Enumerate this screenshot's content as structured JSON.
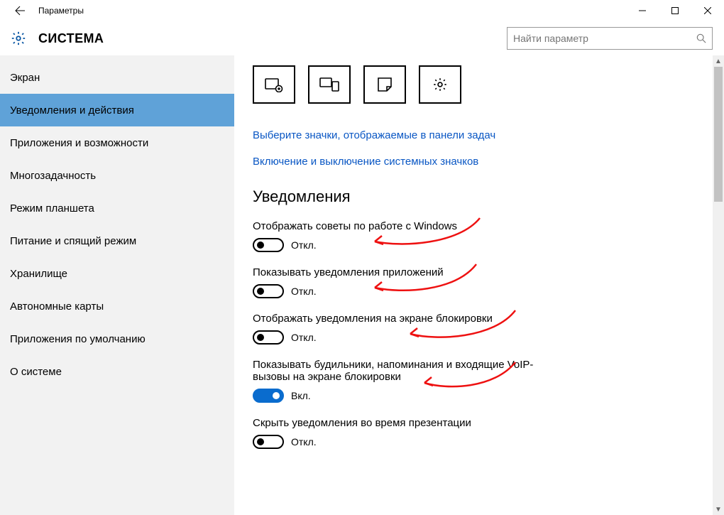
{
  "titlebar": {
    "title": "Параметры"
  },
  "header": {
    "title": "СИСТЕМА"
  },
  "search": {
    "placeholder": "Найти параметр"
  },
  "sidebar": {
    "items": [
      {
        "label": "Экран",
        "selected": false
      },
      {
        "label": "Уведомления и действия",
        "selected": true
      },
      {
        "label": "Приложения и возможности",
        "selected": false
      },
      {
        "label": "Многозадачность",
        "selected": false
      },
      {
        "label": "Режим планшета",
        "selected": false
      },
      {
        "label": "Питание и спящий режим",
        "selected": false
      },
      {
        "label": "Хранилище",
        "selected": false
      },
      {
        "label": "Автономные карты",
        "selected": false
      },
      {
        "label": "Приложения по умолчанию",
        "selected": false
      },
      {
        "label": "О системе",
        "selected": false
      }
    ]
  },
  "links": {
    "taskbar_icons": "Выберите значки, отображаемые в панели задач",
    "system_icons": "Включение и выключение системных значков"
  },
  "section": {
    "notifications": "Уведомления"
  },
  "toggles": [
    {
      "label": "Отображать советы по работе с Windows",
      "on": false,
      "state": "Откл."
    },
    {
      "label": "Показывать уведомления приложений",
      "on": false,
      "state": "Откл."
    },
    {
      "label": "Отображать уведомления на экране блокировки",
      "on": false,
      "state": "Откл."
    },
    {
      "label": "Показывать будильники, напоминания и входящие VoIP-вызовы на экране блокировки",
      "on": true,
      "state": "Вкл."
    },
    {
      "label": "Скрыть уведомления во время презентации",
      "on": false,
      "state": "Откл."
    }
  ]
}
